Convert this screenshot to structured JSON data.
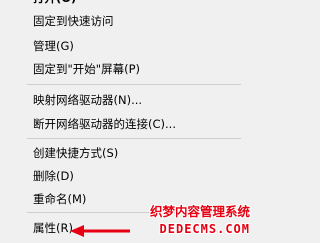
{
  "menu": {
    "items": [
      {
        "label": "打开(O)"
      },
      {
        "label": "固定到快速访问"
      },
      {
        "label": "管理(G)"
      },
      {
        "label": "固定到\"开始\"屏幕(P)"
      },
      {
        "label": "映射网络驱动器(N)..."
      },
      {
        "label": "断开网络驱动器的连接(C)..."
      },
      {
        "label": "创建快捷方式(S)"
      },
      {
        "label": "删除(D)"
      },
      {
        "label": "重命名(M)"
      },
      {
        "label": "属性(R)"
      }
    ]
  },
  "watermark": {
    "line1": "织梦内容管理系统",
    "line2": "DEDECMS.COM"
  },
  "colors": {
    "menu_background": "#f0f0f0",
    "separator": "#cfcfcf",
    "annotation_red": "#e60012"
  }
}
